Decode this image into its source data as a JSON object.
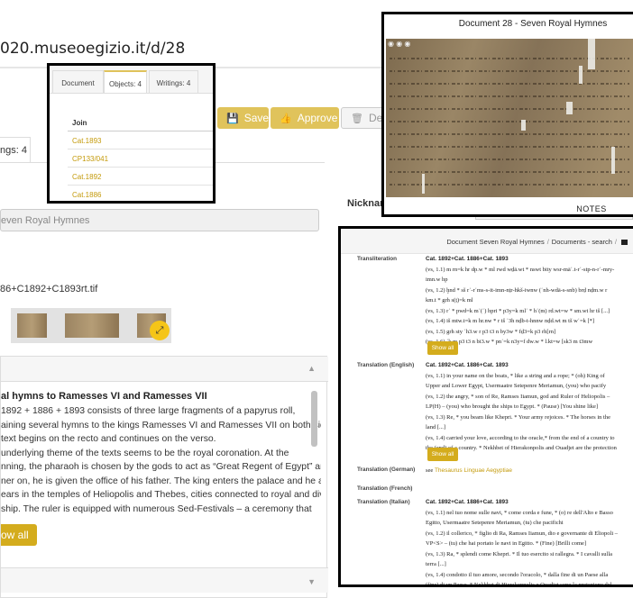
{
  "base": {
    "url_fragment": "020.museoegizio.it/d/28",
    "tab_fragment": "ngs: 4",
    "buttons": {
      "save": "Save",
      "approve": "Approve",
      "delete": "Dele"
    },
    "nickname_label": "Nicknam",
    "title_value": "even Royal Hymnes",
    "image_filename": "86+C1892+C1893rt.tif",
    "description": {
      "title": "al hymns to Ramesses VI and Ramesses VII",
      "lines": [
        "1892 + 1886 + 1893 consists of three large fragments of a papyrus roll,",
        "aining several hymns to the kings Ramesses VI and Ramesses VII on both sides.",
        "text begins on the recto and continues on the verso.",
        "underlying theme of the texts seems to be the royal coronation. At the",
        "nning, the pharaoh is chosen by the gods to act as “Great Regent of Egypt” and,",
        "ner on, he is given the office of his father. The king enters the palace and he also",
        "ears in the temples of Heliopolis and Thebes, cities connected to royal and divine",
        "ship. The ruler is equipped with numerous Sed-Festivals – a ceremony that"
      ],
      "show_all": "ow all"
    }
  },
  "objects_overlay": {
    "tabs": [
      "Document",
      "Objects: 4",
      "Writings: 4"
    ],
    "table_header": "Join",
    "rows": [
      "Cat.1893",
      "CP133/041",
      "Cat.1892",
      "Cat.1886"
    ]
  },
  "viewer_overlay": {
    "title": "Document 28 - Seven Royal Hymnes",
    "notes_label": "NOTES"
  },
  "translation_overlay": {
    "breadcrumb": [
      "Document Seven Royal Hymnes",
      "Documents - search"
    ],
    "transliteration": {
      "label": "Transliteration",
      "head": "Cat. 1892+Cat. 1886+Cat. 1893",
      "lines": [
        "(vs, 1.1) m rn=k hr dp.w * ml rwd wḏā.wt * nswt bity wsr-māʿ.t-rʿ-stp-n-rʿ-mry-",
        "imn.w hp",
        "(vs, 1.2) ḫnd * sš rʿ-rʿms-s-it-imn-nṯr-hkš-iwnw (ʿnh-wdā-s-snb) brḏ nḏm.w r",
        "km.t * grh s(ṯ)=k ml",
        "(vs, 1.3) rʿ * pwd=k mʿ(ʿ) hpri * p3y=k mlʿ * hʿ(m) rd.wt=w * sm.wt hr tš [...]",
        "(vs, 1.4) iš mtw.t=k m hr.nw * r tš ʿ3h nḏb-t-hnnw nḏd.wt m tš wʿ=k [*]",
        "(vs, 1.5) grh sty ʿh3.w r p3 t3 n by3w * fḏ3=k p3 rh[rn]",
        "(vs, 1.6) ʿk m p3 t3 n bi3.w * pnʿ=k n3y=f dw.w * l.kt=w [sk3 m t3mw"
      ]
    },
    "translation_english": {
      "label": "Translation (English)",
      "head": "Cat. 1892+Cat. 1886+Cat. 1893",
      "lines": [
        "(vs, 1.1) in your name on the boats, * like a string and a rope; * (oh) King of",
        "Upper and Lower Egypt, Usermaatre Setepenre Meriamun, (you) who pacify",
        "(vs, 1.2) the angry, * son of Re, Ramses Iiamun, god and Ruler of Heliopolis –",
        "LP(H) – (you) who brought the ships to Egypt. * (Pause) [You shine like]",
        "(vs, 1.3) Re, * you beam like Khepri. * Your army rejoices. * The horses in the",
        "land [...]",
        "(vs, 1.4) carried your love, according to the oracle,* from the end of a country to",
        "the (end) of a country. * Nekhbet of Hierakonpolis and Ouadjet are the protection"
      ]
    },
    "translation_german": {
      "label": "Translation (German)",
      "see": "see",
      "link": "Thesaurus Linguae Aegyptiae"
    },
    "translation_french": {
      "label": "Translation (French)"
    },
    "translation_italian": {
      "label": "Translation (Italian)",
      "head": "Cat. 1892+Cat. 1886+Cat. 1893",
      "lines": [
        "(vs, 1.1) nel tuo nome sulle navi, * come corda e fune, * (o) re dell'Alto e Basso",
        "Egitto, Usermaatre Setepenre Meriamun, (tu) che pacifichi",
        "(vs, 1.2) il collerico, * figlio di Ra, Ramses Iiamun, dio e governante di Eliopoli –",
        "VP<S> – (tu) che hai portato le navi in Egitto. * (Fine) [Brilli come]",
        "(vs, 1.3) Ra, * splendi come Khepri. * Il tuo esercito si rallegra. * I cavalli sulla",
        "terra [...]",
        "(vs, 1.4) condotto il tuo amore, secondo l'oracolo, * dalla fine di un Paese alla",
        "(fine) di un Paese. * Nekhbet di Hierakonpolis e Ouadjet sono la protezione del"
      ]
    },
    "show_all": "Show all"
  },
  "colors": {
    "accent": "#e0c35b",
    "button_gold": "#d4ac1d",
    "link": "#c49a0a"
  }
}
